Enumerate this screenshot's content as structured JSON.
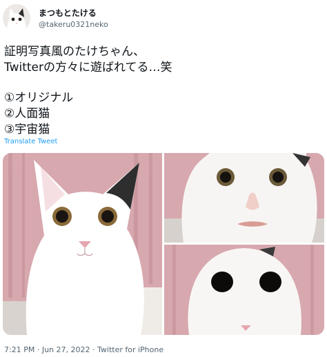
{
  "author": {
    "display_name": "まつもとたける",
    "handle": "@takeru0321neko"
  },
  "tweet": {
    "lines": [
      "証明写真風のたけちゃん、",
      "Twitterの方々に遊ばれてる…笑",
      "",
      "①オリジナル",
      "②人面猫",
      "③宇宙猫"
    ],
    "translate_label": "Translate Tweet"
  },
  "media": {
    "images": [
      {
        "name": "cat-photo-original"
      },
      {
        "name": "cat-photo-human-face"
      },
      {
        "name": "cat-photo-space-cat"
      }
    ]
  },
  "meta": {
    "time": "7:21 PM",
    "sep1": " · ",
    "date": "Jun 27, 2022",
    "sep2": " · ",
    "source": "Twitter for iPhone"
  },
  "colors": {
    "link": "#1d9bf0",
    "secondary_text": "#536471",
    "curtain_pink": "#d9a9b0"
  }
}
